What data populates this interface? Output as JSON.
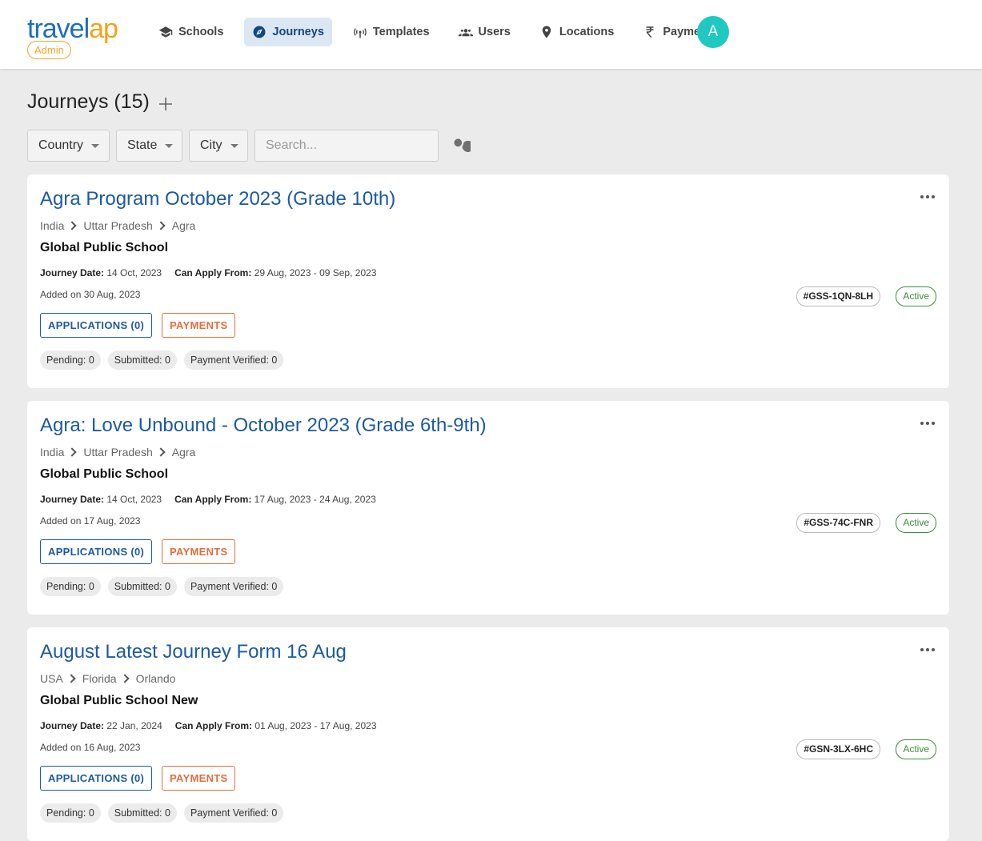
{
  "brand": {
    "logo_a": "travel",
    "logo_b": "ap",
    "role_badge": "Admin",
    "avatar_initial": "A"
  },
  "nav": [
    {
      "label": "Schools",
      "icon": "graduation-cap-icon",
      "active": false
    },
    {
      "label": "Journeys",
      "icon": "compass-icon",
      "active": true
    },
    {
      "label": "Templates",
      "icon": "broadcast-icon",
      "active": false
    },
    {
      "label": "Users",
      "icon": "users-icon",
      "active": false
    },
    {
      "label": "Locations",
      "icon": "location-pin-icon",
      "active": false
    },
    {
      "label": "Payments",
      "icon": "rupee-icon",
      "active": false
    }
  ],
  "page": {
    "title": "Journeys (15)"
  },
  "filters": {
    "country": "Country",
    "state": "State",
    "city": "City",
    "search_placeholder": "Search..."
  },
  "labels": {
    "journey_date": "Journey Date:",
    "can_apply_from": "Can Apply From:",
    "applications_btn": "APPLICATIONS (0)",
    "payments_btn": "PAYMENTS"
  },
  "journeys": [
    {
      "title": "Agra Program October 2023 (Grade 10th)",
      "country": "India",
      "state": "Uttar Pradesh",
      "city": "Agra",
      "school": "Global Public School",
      "journey_date": "14 Oct, 2023",
      "apply_range": "29 Aug, 2023 - 09 Sep, 2023",
      "added": "Added on 30 Aug, 2023",
      "code": "#GSS-1QN-8LH",
      "status": "Active",
      "pending": "Pending: 0",
      "submitted": "Submitted: 0",
      "verified": "Payment Verified: 0"
    },
    {
      "title": "Agra: Love Unbound - October 2023 (Grade 6th-9th)",
      "country": "India",
      "state": "Uttar Pradesh",
      "city": "Agra",
      "school": "Global Public School",
      "journey_date": "14 Oct, 2023",
      "apply_range": "17 Aug, 2023 - 24 Aug, 2023",
      "added": "Added on 17 Aug, 2023",
      "code": "#GSS-74C-FNR",
      "status": "Active",
      "pending": "Pending: 0",
      "submitted": "Submitted: 0",
      "verified": "Payment Verified: 0"
    },
    {
      "title": "August Latest Journey Form 16 Aug",
      "country": "USA",
      "state": "Florida",
      "city": "Orlando",
      "school": "Global Public School New",
      "journey_date": "22 Jan, 2024",
      "apply_range": "01 Aug, 2023 - 17 Aug, 2023",
      "added": "Added on 16 Aug, 2023",
      "code": "#GSN-3LX-6HC",
      "status": "Active",
      "pending": "Pending: 0",
      "submitted": "Submitted: 0",
      "verified": "Payment Verified: 0"
    }
  ]
}
